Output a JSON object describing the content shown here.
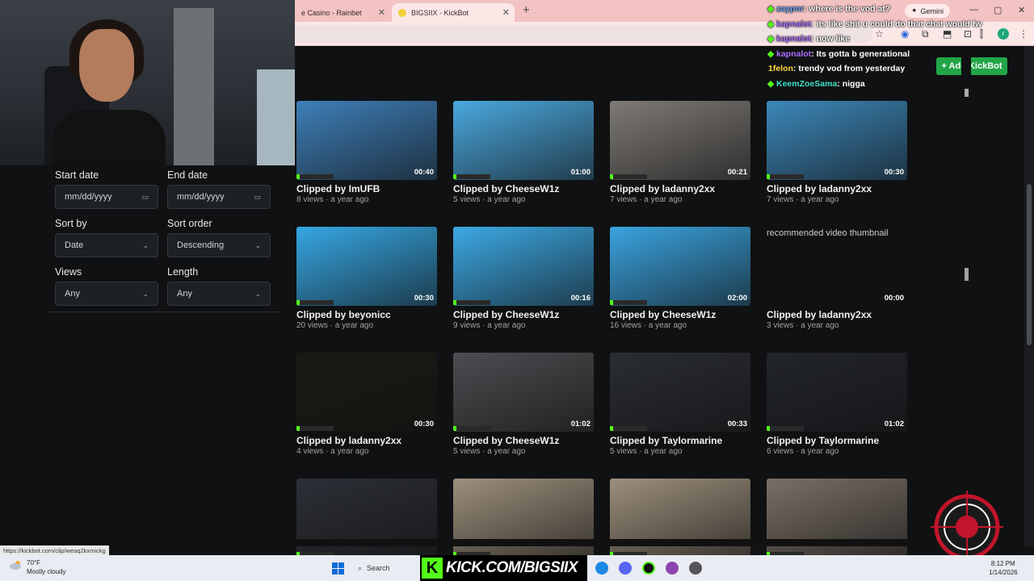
{
  "browser": {
    "tabs": [
      {
        "label": "e Casino - Rainbet"
      },
      {
        "label": "BIGSIIX - KickBot"
      }
    ],
    "new_tab": "+",
    "gemini_label": "Gemini",
    "window_controls": [
      "—",
      "▢",
      "✕"
    ]
  },
  "chat": [
    {
      "user": "zaypnr",
      "message": ": where is the vod at?",
      "color": "#6aa9ff"
    },
    {
      "user": "kapnalot",
      "message": ": its like shit u could do that chat would fw",
      "color": "#b06cff"
    },
    {
      "user": "kapnalot",
      "message": ": now like",
      "color": "#b06cff"
    },
    {
      "user": "kapnalot",
      "message": ": Its gotta b generational",
      "color": "#b06cff"
    },
    {
      "user": "1felon",
      "message": ": trendy vod from yesterday",
      "color": "#ffd93d"
    },
    {
      "user": "KeemZoeSama",
      "message": ": nigga",
      "color": "#3ee0c2"
    }
  ],
  "add_kickbot": "+ Add KickBot",
  "filters": {
    "start_date_label": "Start date",
    "start_date_placeholder": "mm/dd/yyyy",
    "end_date_label": "End date",
    "end_date_placeholder": "mm/dd/yyyy",
    "sort_by_label": "Sort by",
    "sort_by_value": "Date",
    "sort_order_label": "Sort order",
    "sort_order_value": "Descending",
    "views_label": "Views",
    "views_value": "Any",
    "length_label": "Length",
    "length_value": "Any"
  },
  "clips": [
    {
      "title": "Clipped by ImUFB",
      "meta": "8 views · a year ago",
      "duration": "00:40",
      "thumb": "#3e7fb8"
    },
    {
      "title": "Clipped by CheeseW1z",
      "meta": "5 views · a year ago",
      "duration": "01:00",
      "thumb": "#4aa8de"
    },
    {
      "title": "Clipped by ladanny2xx",
      "meta": "7 views · a year ago",
      "duration": "00:21",
      "thumb": "#7e7a76"
    },
    {
      "title": "Clipped by ladanny2xx",
      "meta": "7 views · a year ago",
      "duration": "00:30",
      "thumb": "#3c87b9"
    },
    {
      "title": "Clipped by beyonicc",
      "meta": "20 views · a year ago",
      "duration": "00:30",
      "thumb": "#36a7e3"
    },
    {
      "title": "Clipped by CheeseW1z",
      "meta": "9 views · a year ago",
      "duration": "00:16",
      "thumb": "#3ca9e4"
    },
    {
      "title": "Clipped by CheeseW1z",
      "meta": "16 views · a year ago",
      "duration": "02:00",
      "thumb": "#3aa3df"
    },
    {
      "title": "Clipped by ladanny2xx",
      "meta": "3 views · a year ago",
      "duration": "00:00",
      "thumb": "none",
      "alt": "recommended video thumbnail"
    },
    {
      "title": "Clipped by ladanny2xx",
      "meta": "4 views · a year ago",
      "duration": "00:30",
      "thumb": "#1a1a14"
    },
    {
      "title": "Clipped by CheeseW1z",
      "meta": "5 views · a year ago",
      "duration": "01:02",
      "thumb": "#4b4d50"
    },
    {
      "title": "Clipped by Taylormarine",
      "meta": "5 views · a year ago",
      "duration": "00:33",
      "thumb": "#2a2d33"
    },
    {
      "title": "Clipped by Taylormarine",
      "meta": "6 views · a year ago",
      "duration": "01:02",
      "thumb": "#22252b"
    },
    {
      "title": "",
      "meta": "",
      "duration": "",
      "thumb": "#2c2f36"
    },
    {
      "title": "",
      "meta": "",
      "duration": "",
      "thumb": "#9c8f7c"
    },
    {
      "title": "",
      "meta": "",
      "duration": "",
      "thumb": "#9c8f7c"
    },
    {
      "title": "",
      "meta": "",
      "duration": "",
      "thumb": "#7a6f66"
    }
  ],
  "status_url": "https://kickbot.com/clip/weaq2kxmickg",
  "taskbar": {
    "temp": "70°F",
    "weather": "Mostly cloudy",
    "search": "Search",
    "kick_banner": "KICK.COM/BIGSIIX",
    "time": "8:12 PM",
    "date": "1/14/2026"
  },
  "colors": {
    "accent": "#21a547",
    "kick_green": "#53fc18",
    "tab_bar": "#f3c2c2"
  }
}
